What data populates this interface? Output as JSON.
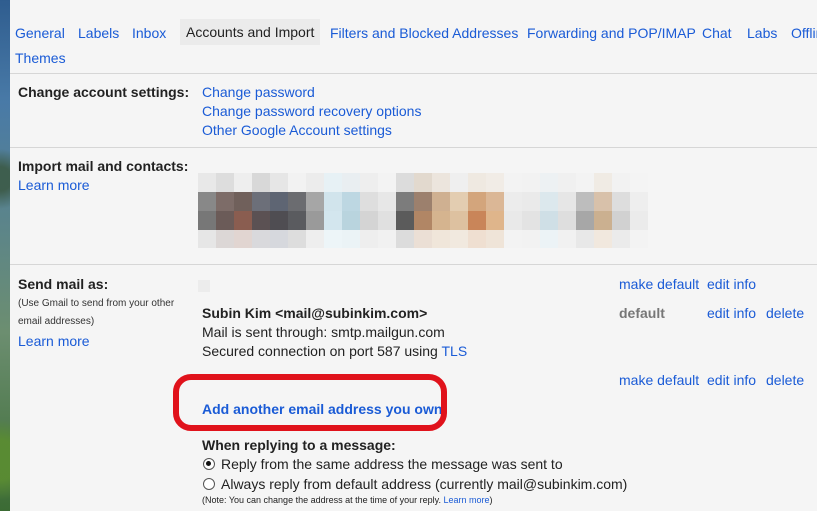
{
  "tabs": [
    "General",
    "Labels",
    "Inbox",
    "Accounts and Import",
    "Filters and Blocked Addresses",
    "Forwarding and POP/IMAP",
    "Chat",
    "Labs",
    "Offline",
    "Themes"
  ],
  "change_settings": {
    "title": "Change account settings:",
    "links": [
      "Change password",
      "Change password recovery options",
      "Other Google Account settings"
    ]
  },
  "import": {
    "title": "Import mail and contacts:",
    "learn_more": "Learn more"
  },
  "send_mail": {
    "title": "Send mail as:",
    "subtitle": "(Use Gmail to send from your other email addresses)",
    "learn_more": "Learn more",
    "row1": {
      "make_default": "make default",
      "edit_info": "edit info"
    },
    "account": {
      "name": "Subin Kim <mail@subinkim.com>",
      "through": "Mail is sent through: smtp.mailgun.com",
      "secured": "Secured connection on port 587 using ",
      "tls": "TLS",
      "default_label": "default",
      "edit_info": "edit info",
      "delete": "delete"
    },
    "row3": {
      "make_default": "make default",
      "edit_info": "edit info",
      "delete": "delete"
    },
    "add_link": "Add another email address you own",
    "replying_title": "When replying to a message:",
    "reply_same": "Reply from the same address the message was sent to",
    "reply_default": "Always reply from default address (currently mail@subinkim.com)",
    "note": "(Note: You can change the address at the time of your reply.",
    "note_link": "Learn more",
    "note_end": ")"
  }
}
